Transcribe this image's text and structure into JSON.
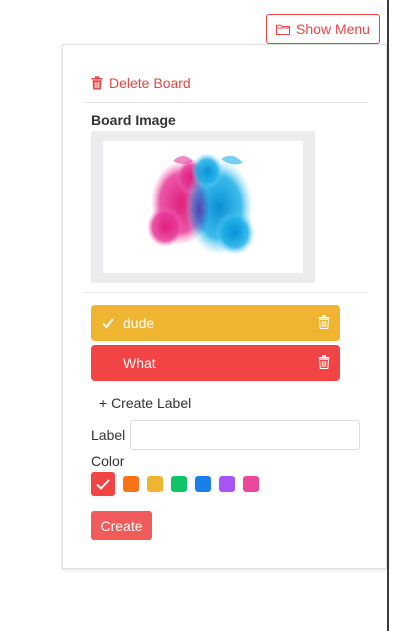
{
  "header": {
    "show_menu_label": "Show Menu"
  },
  "panel": {
    "delete_board_label": "Delete Board",
    "board_image_title": "Board Image",
    "labels": [
      {
        "name": "dude",
        "color": "#f0b530",
        "checked": true
      },
      {
        "name": "What",
        "color": "#f24444",
        "checked": false
      }
    ],
    "create_label_text": "+ Create Label",
    "label_field_label": "Label",
    "label_field_value": "",
    "color_field_label": "Color",
    "colors": [
      {
        "hex": "#f24444",
        "selected": true
      },
      {
        "hex": "#f97316",
        "selected": false
      },
      {
        "hex": "#f0b530",
        "selected": false
      },
      {
        "hex": "#10c46a",
        "selected": false
      },
      {
        "hex": "#1a7fe8",
        "selected": false
      },
      {
        "hex": "#a855f7",
        "selected": false
      },
      {
        "hex": "#ec4899",
        "selected": false
      }
    ],
    "create_button_label": "Create"
  },
  "accent_color": "#e84545"
}
